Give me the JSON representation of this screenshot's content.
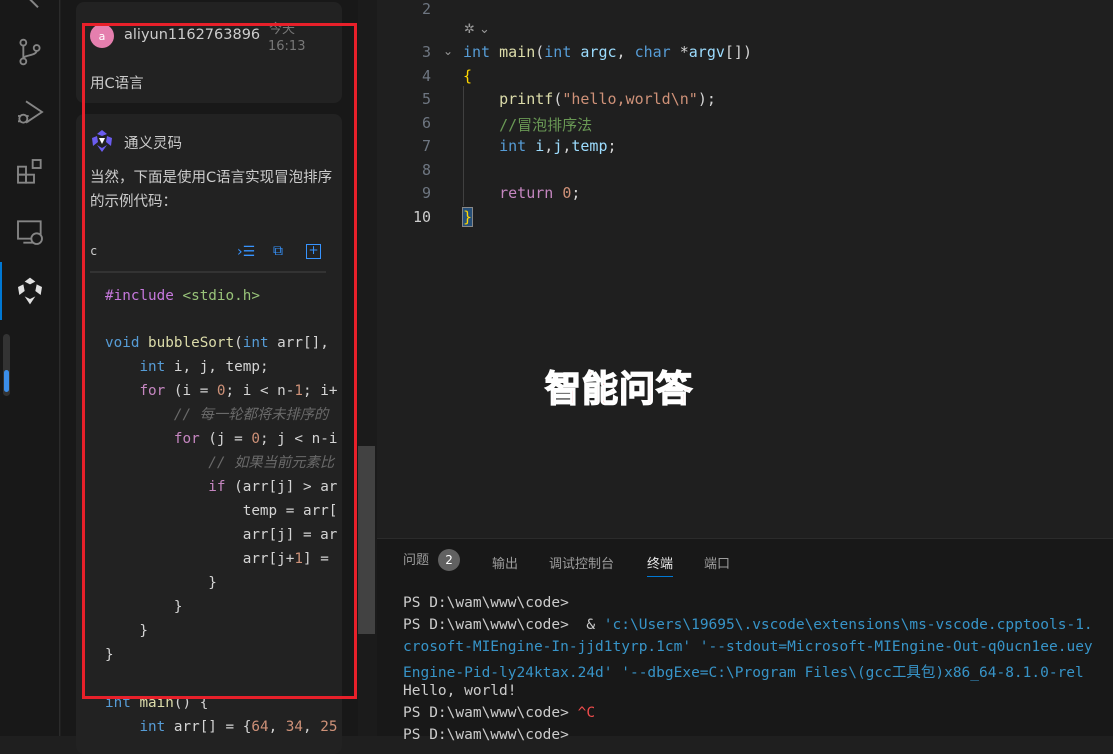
{
  "activity_bar": {
    "items": [
      "explorer-icon",
      "source-control-icon",
      "run-debug-icon",
      "extensions-icon",
      "remote-explorer-icon",
      "tongyi-lingma-icon"
    ]
  },
  "chat": {
    "user": {
      "avatar_letter": "a",
      "name": "aliyun1162763896",
      "date": "今天",
      "time": "16:13",
      "message": "用C语言"
    },
    "assistant": {
      "name": "通义灵码",
      "message": "当然，下面是使用C语言实现冒泡排序的示例代码：",
      "code_lang": "c",
      "code_lines": [
        "#include <stdio.h>",
        "",
        "void bubbleSort(int arr[],",
        "    int i, j, temp;",
        "    for (i = 0; i < n-1; i+",
        "        // 每一轮都将未排序的",
        "        for (j = 0; j < n-i",
        "            // 如果当前元素比",
        "            if (arr[j] > ar",
        "                temp = arr[",
        "                arr[j] = ar",
        "                arr[j+1] = ",
        "            }",
        "        }",
        "    }",
        "}",
        "",
        "int main() {",
        "    int arr[] = {64, 34, 25"
      ]
    },
    "actions": [
      "insert-icon",
      "copy-icon",
      "new-file-icon"
    ]
  },
  "editor": {
    "lines": [
      {
        "n": "2",
        "t": ""
      },
      {
        "n": "3",
        "t": "int main(int argc, char *argv[])"
      },
      {
        "n": "4",
        "t": "{"
      },
      {
        "n": "5",
        "t": "    printf(\"hello,world\\n\");"
      },
      {
        "n": "6",
        "t": "    //冒泡排序法"
      },
      {
        "n": "7",
        "t": "    int i,j,temp;"
      },
      {
        "n": "8",
        "t": ""
      },
      {
        "n": "9",
        "t": "    return 0;"
      },
      {
        "n": "10",
        "t": "}"
      }
    ]
  },
  "overlay_label": "智能问答",
  "panel": {
    "tabs": [
      {
        "label": "问题",
        "badge": "2"
      },
      {
        "label": "输出"
      },
      {
        "label": "调试控制台"
      },
      {
        "label": "终端",
        "active": true
      },
      {
        "label": "端口"
      }
    ],
    "terminal": [
      {
        "t": "PS D:\\wam\\www\\code>",
        "c": "#cccccc"
      },
      {
        "t": "PS D:\\wam\\www\\code>  & 'c:\\Users\\19695\\.vscode\\extensions\\ms-vscode.cpptools-1.",
        "c": "mixed"
      },
      {
        "t": "crosoft-MIEngine-In-jjd1tyrp.1cm' '--stdout=Microsoft-MIEngine-Out-q0ucn1ee.uey",
        "c": "#3794c8"
      },
      {
        "t": "Engine-Pid-ly24ktax.24d' '--dbgExe=C:\\Program Files\\(gcc工具包)x86_64-8.1.0-rel",
        "c": "#3794c8"
      },
      {
        "t": "Hello, world!",
        "c": "#cccccc"
      },
      {
        "t": "PS D:\\wam\\www\\code> ^C",
        "c": "ctrlc"
      },
      {
        "t": "PS D:\\wam\\www\\code>",
        "c": "#cccccc"
      }
    ]
  }
}
